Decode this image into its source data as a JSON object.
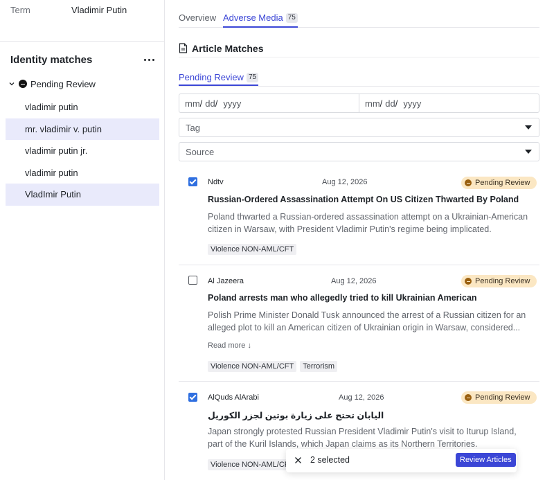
{
  "term": {
    "label": "Term",
    "value": "Vladimir Putin"
  },
  "identity": {
    "title": "Identity matches",
    "group_label": "Pending Review",
    "items": [
      {
        "label": "vladimir putin",
        "selected": false
      },
      {
        "label": "mr. vladimir v. putin",
        "selected": true
      },
      {
        "label": "vladimir putin jr.",
        "selected": false
      },
      {
        "label": "vladimir putin",
        "selected": false
      },
      {
        "label": "VladImir Putin",
        "selected": true
      }
    ]
  },
  "tabs": [
    {
      "label": "Overview",
      "active": false
    },
    {
      "label": "Adverse Media",
      "count": "75",
      "active": true
    }
  ],
  "section": {
    "title": "Article Matches"
  },
  "subtab": {
    "label": "Pending Review",
    "count": "75"
  },
  "date_filter": {
    "start": {
      "mm": "mm",
      "dd": "dd",
      "yyyy": "yyyy"
    },
    "end": {
      "mm": "mm",
      "dd": "dd",
      "yyyy": "yyyy"
    }
  },
  "filters": {
    "tag_placeholder": "Tag",
    "source_placeholder": "Source"
  },
  "articles": [
    {
      "checked": true,
      "source": "Ndtv",
      "date": "Aug 12, 2026",
      "status": "Pending Review",
      "title": "Russian-Ordered Assassination Attempt On US Citizen Thwarted By Poland",
      "description": "Poland thwarted a Russian-ordered assassination attempt on a Ukrainian-American citizen in Warsaw, with President Vladimir Putin's regime being implicated.",
      "tags": [
        "Violence NON-AML/CFT"
      ]
    },
    {
      "checked": false,
      "source": "Al Jazeera",
      "date": "Aug 12, 2026",
      "status": "Pending Review",
      "title": "Poland arrests man who allegedly tried to kill Ukrainian American",
      "description": "Polish Prime Minister Donald Tusk announced the arrest of a Russian citizen for an alleged plot to kill an American citizen of Ukrainian origin in Warsaw, considered...",
      "read_more": "Read more",
      "tags": [
        "Violence NON-AML/CFT",
        "Terrorism"
      ]
    },
    {
      "checked": true,
      "source": "AlQuds AlArabi",
      "date": "Aug 12, 2026",
      "status": "Pending Review",
      "title": "اليابان تحتج على زيارة بوتين لجزر الكوريل",
      "description": "Japan strongly protested Russian President Vladimir Putin's visit to Iturup Island, part of the Kuril Islands, which Japan claims as its Northern Territories.",
      "tags": [
        "Violence NON-AML/CFT"
      ]
    }
  ],
  "action_bar": {
    "selected_text": "2 selected",
    "button_label": "Review Articles"
  },
  "colors": {
    "accent": "#3b46d6",
    "selected_row": "#e9eafb",
    "pending_badge": "#fbe7c3",
    "checkbox": "#2f6fe0"
  }
}
